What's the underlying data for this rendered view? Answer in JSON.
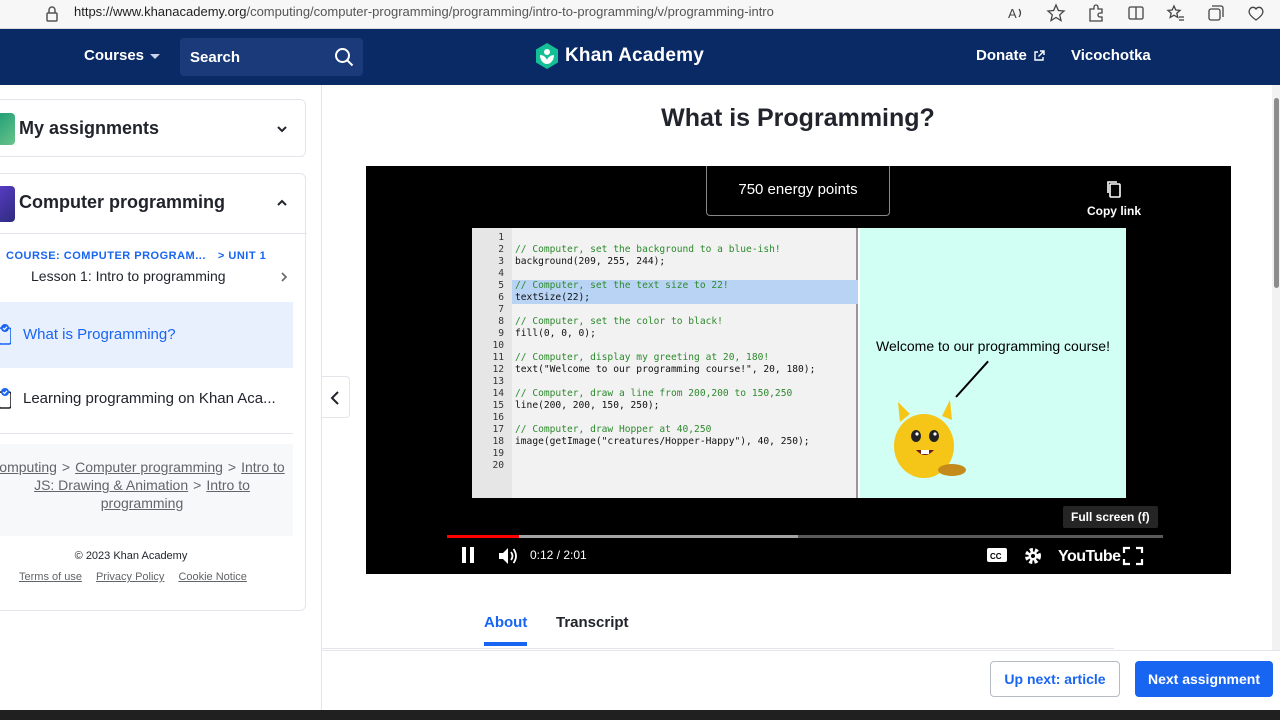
{
  "browser": {
    "url_host": "https://www.khanacademy.org",
    "url_path": "/computing/computer-programming/programming/intro-to-programming/v/programming-intro",
    "icons": [
      "read-aloud-icon",
      "favorite-star-icon",
      "extensions-icon",
      "split-screen-icon",
      "favorites-icon",
      "collections-icon",
      "browser-essentials-icon"
    ]
  },
  "header": {
    "courses_label": "Courses",
    "search_placeholder": "Search",
    "logo_text": "Khan Academy",
    "donate_label": "Donate",
    "user_name": "Vicochotka"
  },
  "sidebar": {
    "assignments_title": "My assignments",
    "course_title": "Computer programming",
    "course_label": "COURSE: COMPUTER PROGRAM...",
    "unit_label": "> UNIT 1",
    "lesson_title": "Lesson 1: Intro to programming",
    "items": [
      {
        "label": "What is Programming?",
        "active": true
      },
      {
        "label": "Learning programming on Khan Aca...",
        "active": false
      }
    ],
    "breadcrumbs": [
      "omputing",
      "Computer programming",
      "Intro to JS: Drawing & Animation",
      "Intro to programming"
    ],
    "breadcrumb_sep": ">",
    "copyright": "© 2023 Khan Academy",
    "footer_links": [
      "Terms of use",
      "Privacy Policy",
      "Cookie Notice"
    ]
  },
  "main": {
    "title": "What is Programming?",
    "video": {
      "energy_points": "750 energy points",
      "copy_link_label": "Copy link",
      "fullscreen_tooltip": "Full screen (f)",
      "time": "0:12 / 2:01",
      "progress_fraction": 0.1,
      "buffered_fraction": 0.49,
      "youtube_label": "YouTube",
      "code_lines": [
        {
          "n": "1",
          "text": "",
          "kind": "code"
        },
        {
          "n": "2",
          "text": "// Computer, set the background to a blue-ish!",
          "kind": "comment"
        },
        {
          "n": "3",
          "text": "background(209, 255, 244);",
          "kind": "code"
        },
        {
          "n": "4",
          "text": "",
          "kind": "code"
        },
        {
          "n": "5",
          "text": "// Computer, set the text size to 22!",
          "kind": "comment"
        },
        {
          "n": "6",
          "text": "textSize(22);",
          "kind": "code"
        },
        {
          "n": "7",
          "text": "",
          "kind": "code"
        },
        {
          "n": "8",
          "text": "// Computer, set the color to black!",
          "kind": "comment"
        },
        {
          "n": "9",
          "text": "fill(0, 0, 0);",
          "kind": "code"
        },
        {
          "n": "10",
          "text": "",
          "kind": "code"
        },
        {
          "n": "11",
          "text": "// Computer, display my greeting at 20, 180!",
          "kind": "comment"
        },
        {
          "n": "12",
          "text": "text(\"Welcome to our programming course!\", 20, 180);",
          "kind": "code"
        },
        {
          "n": "13",
          "text": "",
          "kind": "code"
        },
        {
          "n": "14",
          "text": "// Computer, draw a line from 200,200 to 150,250",
          "kind": "comment"
        },
        {
          "n": "15",
          "text": "line(200, 200, 150, 250);",
          "kind": "code"
        },
        {
          "n": "16",
          "text": "",
          "kind": "code"
        },
        {
          "n": "17",
          "text": "// Computer, draw Hopper at 40,250",
          "kind": "comment"
        },
        {
          "n": "18",
          "text": "image(getImage(\"creatures/Hopper-Happy\"), 40, 250);",
          "kind": "code"
        },
        {
          "n": "19",
          "text": "",
          "kind": "code"
        },
        {
          "n": "20",
          "text": "",
          "kind": "code"
        }
      ],
      "preview_text": "Welcome to our programming course!"
    },
    "tabs": [
      {
        "label": "About",
        "active": true
      },
      {
        "label": "Transcript",
        "active": false
      }
    ]
  },
  "bottom": {
    "up_next_label": "Up next: article",
    "next_assignment_label": "Next assignment"
  },
  "colors": {
    "header_bg": "#0a2a66",
    "accent": "#1865f2",
    "preview_bg": "#d1fff4"
  }
}
